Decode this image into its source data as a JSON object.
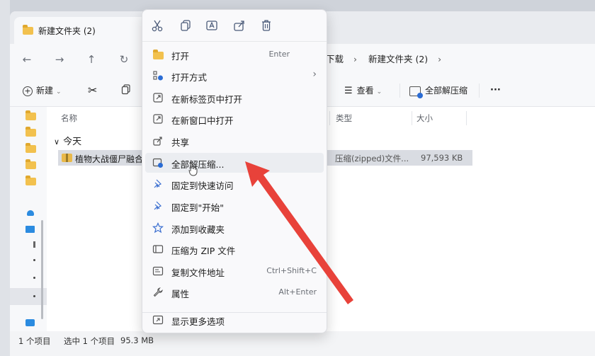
{
  "window": {
    "tab_title": "新建文件夹 (2)",
    "breadcrumb": [
      "下载",
      "新建文件夹 (2)"
    ]
  },
  "toolbar": {
    "new_label": "新建",
    "view_label": "查看",
    "extract_all_label": "全部解压缩",
    "more_label": "···"
  },
  "columns": {
    "name": "名称",
    "type": "类型",
    "size": "大小"
  },
  "group_label": "今天",
  "file": {
    "name": "植物大战僵尸融合版",
    "type": "压缩(zipped)文件...",
    "size": "97,593 KB"
  },
  "status": {
    "count": "1 个项目",
    "selected": "选中 1 个项目",
    "size": "95.3 MB"
  },
  "menu": {
    "items": [
      {
        "label": "打开",
        "shortcut": "Enter",
        "icon": "folder-icon"
      },
      {
        "label": "打开方式",
        "shortcut": "›",
        "icon": "open-with-icon"
      },
      {
        "label": "在新标签页中打开",
        "shortcut": "",
        "icon": "new-tab-icon"
      },
      {
        "label": "在新窗口中打开",
        "shortcut": "",
        "icon": "new-window-icon"
      },
      {
        "label": "共享",
        "shortcut": "",
        "icon": "share-icon"
      },
      {
        "label": "全部解压缩...",
        "shortcut": "",
        "icon": "extract-icon"
      },
      {
        "label": "固定到快速访问",
        "shortcut": "",
        "icon": "pin-icon"
      },
      {
        "label": "固定到\"开始\"",
        "shortcut": "",
        "icon": "pin-start-icon"
      },
      {
        "label": "添加到收藏夹",
        "shortcut": "",
        "icon": "star-icon"
      },
      {
        "label": "压缩为 ZIP 文件",
        "shortcut": "",
        "icon": "zip-icon"
      },
      {
        "label": "复制文件地址",
        "shortcut": "Ctrl+Shift+C",
        "icon": "copy-path-icon"
      },
      {
        "label": "属性",
        "shortcut": "Alt+Enter",
        "icon": "wrench-icon"
      }
    ],
    "more_options": "显示更多选项"
  },
  "colors": {
    "arrow": "#e8423a",
    "folder": "#f2c14e",
    "accent": "#2b6cd4"
  }
}
